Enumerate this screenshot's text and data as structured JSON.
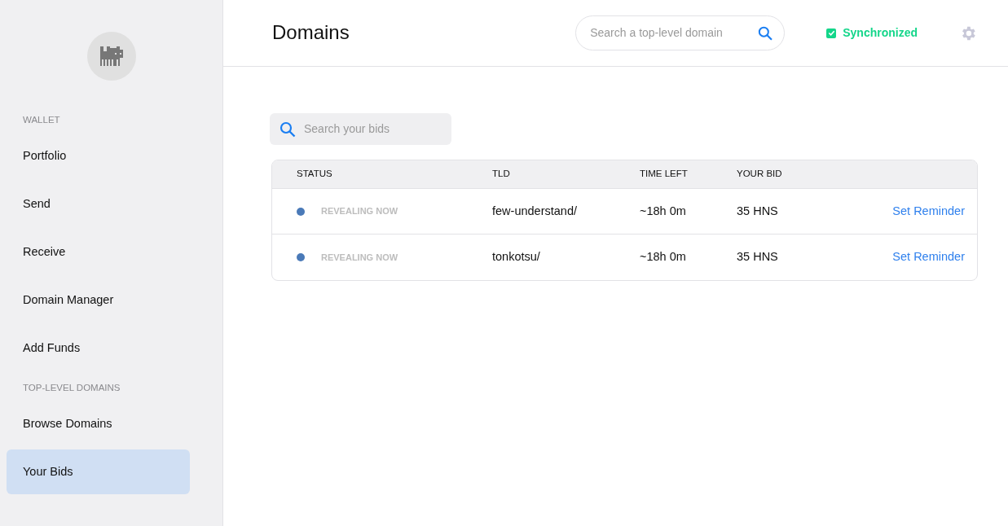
{
  "sidebar": {
    "sections": [
      {
        "heading": "WALLET",
        "items": [
          {
            "label": "Portfolio",
            "selected": false
          },
          {
            "label": "Send",
            "selected": false
          },
          {
            "label": "Receive",
            "selected": false
          },
          {
            "label": "Domain Manager",
            "selected": false
          },
          {
            "label": "Add Funds",
            "selected": false
          }
        ]
      },
      {
        "heading": "TOP-LEVEL DOMAINS",
        "items": [
          {
            "label": "Browse Domains",
            "selected": false
          },
          {
            "label": "Your Bids",
            "selected": true
          }
        ]
      }
    ]
  },
  "header": {
    "title": "Domains",
    "search": {
      "placeholder": "Search a top-level domain"
    },
    "sync": {
      "label": "Synchronized",
      "checked": true
    }
  },
  "bids_search": {
    "placeholder": "Search your bids"
  },
  "table": {
    "columns": [
      "STATUS",
      "TLD",
      "TIME LEFT",
      "YOUR BID"
    ],
    "rows": [
      {
        "status": "REVEALING NOW",
        "color": "#4a7ab8",
        "tld": "few-understand/",
        "time_left": "~18h 0m",
        "bid": "35 HNS",
        "action": "Set Reminder"
      },
      {
        "status": "REVEALING NOW",
        "color": "#4a7ab8",
        "tld": "tonkotsu/",
        "time_left": "~18h 0m",
        "bid": "35 HNS",
        "action": "Set Reminder"
      }
    ]
  }
}
